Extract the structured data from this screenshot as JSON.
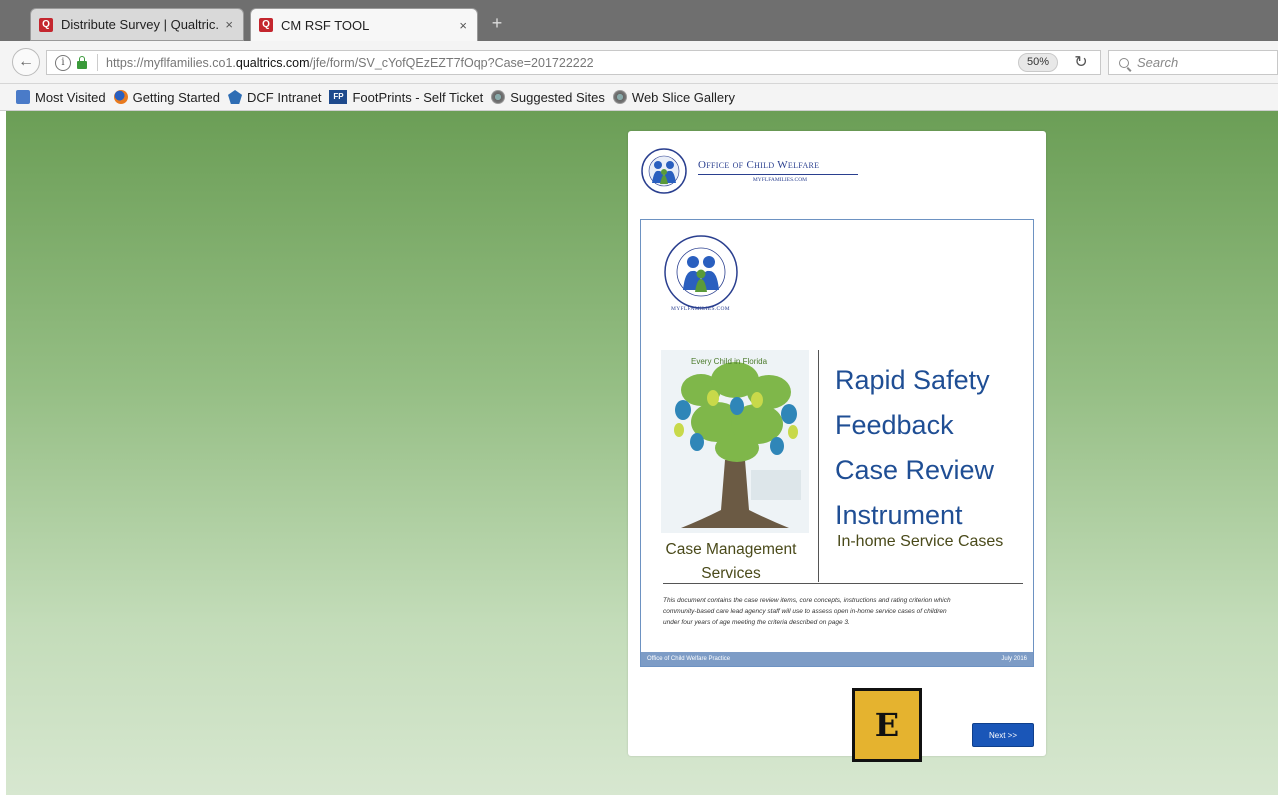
{
  "browser": {
    "tabs": [
      {
        "title": "Distribute Survey | Qualtric...",
        "close": "×"
      },
      {
        "title": "CM RSF TOOL",
        "close": "×"
      }
    ],
    "new_tab": "+",
    "url": {
      "prefix": "https://myflfamilies.co1.",
      "host": "qualtrics.com",
      "path": "/jfe/form/SV_cYofQEzEZT7fOqp?Case=201722222"
    },
    "zoom": "50%",
    "search_placeholder": "Search",
    "bookmarks": [
      {
        "label": "Most Visited",
        "icon": "bookmarks-folder-icon"
      },
      {
        "label": "Getting Started",
        "icon": "firefox-icon"
      },
      {
        "label": "DCF Intranet",
        "icon": "dcf-logo-icon"
      },
      {
        "label": "FootPrints - Self Ticket",
        "icon": "footprints-icon"
      },
      {
        "label": "Suggested Sites",
        "icon": "globe-icon"
      },
      {
        "label": "Web Slice Gallery",
        "icon": "globe-icon"
      }
    ]
  },
  "survey": {
    "header": {
      "org_name": "Office of Child Welfare",
      "website": "MYFLFAMILIES.COM"
    },
    "cover": {
      "seal_site": "MYFLFAMILIES.COM",
      "title_lines": [
        "Rapid Safety",
        "Feedback",
        "Case Review",
        "Instrument"
      ],
      "subtitle": "In-home Service Cases",
      "left_caption_lines": [
        "Case Management",
        "Services"
      ],
      "description": "This document contains the case review items, core concepts, instructions and rating criterion which community-based care lead agency staff will use to assess open in-home service cases of children under four years of age meeting the criteria described on page 3.",
      "footer_left": "Office of Child Welfare Practice",
      "footer_right": "July 2016",
      "tree_caption": "Every Child in Florida"
    },
    "marker_label": "E",
    "next_button": "Next >>"
  },
  "colors": {
    "accent_blue": "#1f4e94",
    "next_button": "#1a56b8",
    "marker": "#e5b32f",
    "background_green": "#6b9e56"
  }
}
